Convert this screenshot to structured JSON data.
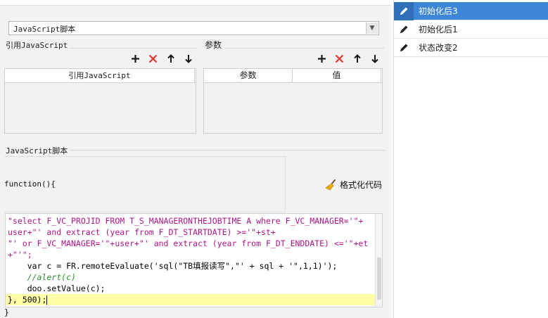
{
  "script_type": {
    "selected": "JavaScript脚本"
  },
  "sections": {
    "ref_js_label": "引用JavaScript",
    "params_label": "参数",
    "js_script_label": "JavaScript脚本"
  },
  "ref_table": {
    "columns": [
      "引用JavaScript"
    ],
    "rows": []
  },
  "param_table": {
    "columns": [
      "参数",
      "值"
    ],
    "rows": []
  },
  "toolbar_icons": [
    "plus-icon",
    "delete-x-icon",
    "arrow-up-icon",
    "arrow-down-icon"
  ],
  "editor": {
    "function_header": "function(){",
    "format_code_label": "格式化代码",
    "code_lines": [
      "\"select F_VC_PROJID FROM T_S_MANAGERONTHEJOBTIME A where F_VC_MANAGER='\"+",
      "user+\"' and extract (year from F_DT_STARTDATE) >='\"+st+",
      "\"' or F_VC_MANAGER='\"+user+\"' and extract (year from F_DT_ENDDATE) <='\"+et",
      "+\"'\";",
      "    var c = FR.remoteEvaluate('sql(\"TB填报读写\",\"' + sql + '\",1,1)');",
      "    //alert(c)",
      "    doo.setValue(c);",
      "}, 500);"
    ],
    "closing": "}"
  },
  "events": [
    {
      "label": "初始化后3",
      "icon": "pencil-icon",
      "selected": true
    },
    {
      "label": "初始化后1",
      "icon": "pencil-icon",
      "selected": false
    },
    {
      "label": "状态改变2",
      "icon": "pencil-icon",
      "selected": false
    }
  ],
  "colors": {
    "selected_event_bg": "#3d85d6",
    "add_icon": "#1a1a1a",
    "delete_icon": "#e53935",
    "string_color": "#b0148a",
    "keyword_color": "#4b3bd1",
    "comment_color": "#2f8f2f",
    "current_line_bg": "#ffffa8"
  }
}
